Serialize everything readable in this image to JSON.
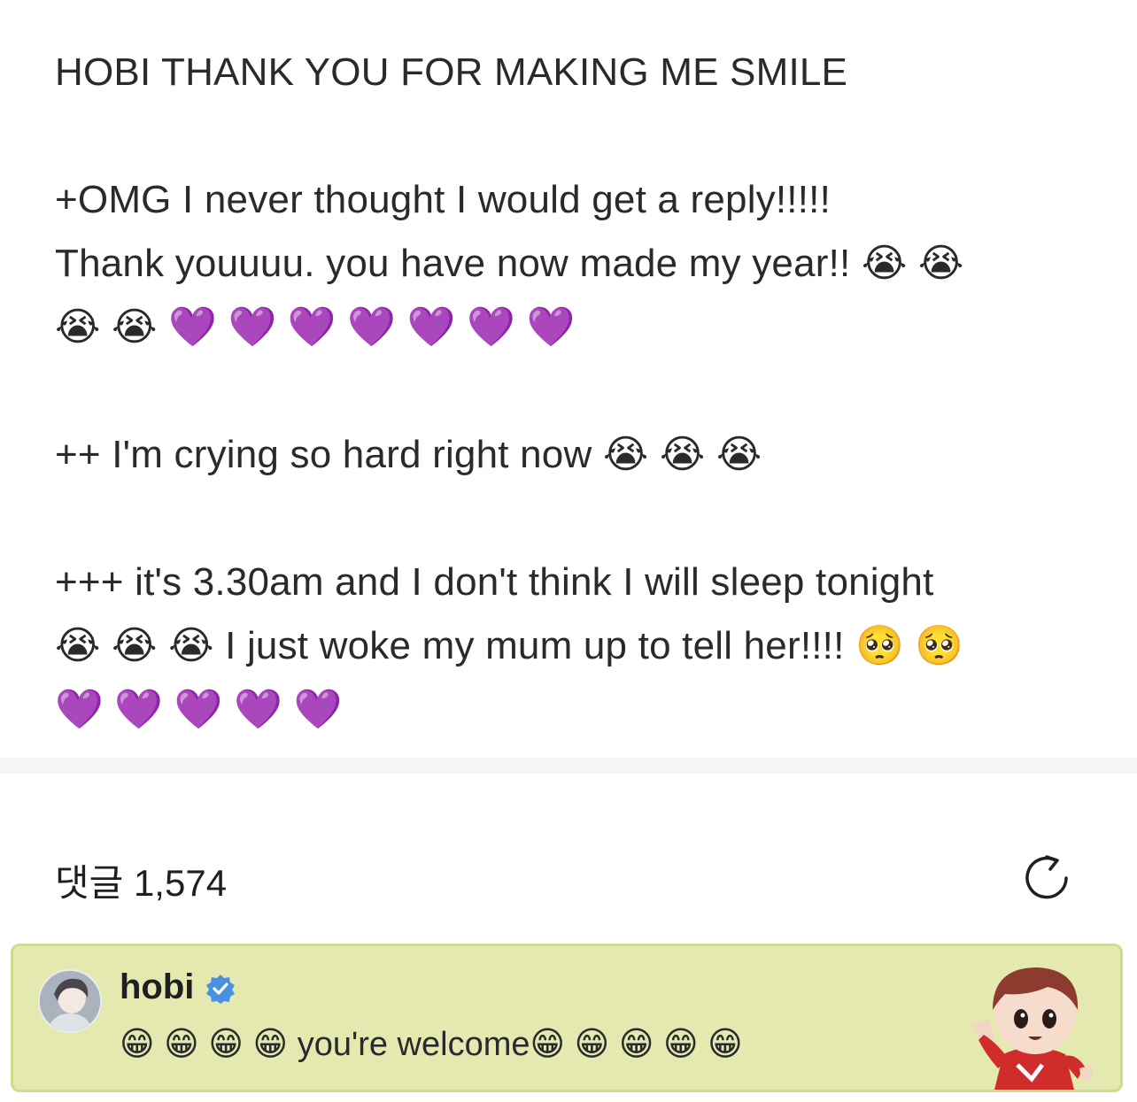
{
  "post": {
    "title": "HOBI THANK YOU FOR MAKING ME SMILE",
    "line_a1": "+OMG I never thought I would get a reply!!!!!",
    "line_a2": "Thank youuuu. you have now made my year!! 😭 😭",
    "line_a3": "😭 😭 💜 💜 💜 💜 💜 💜 💜",
    "line_b1": "++ I'm crying so hard right now 😭 😭 😭",
    "line_c1": "+++ it's 3.30am and I don't think I will sleep tonight",
    "line_c2": "😭 😭 😭 I just woke my mum up to tell her!!!! 🥺 🥺",
    "line_c3": "💜 💜 💜 💜 💜"
  },
  "comments": {
    "title": "댓글 1,574",
    "refresh_icon": "refresh-icon"
  },
  "comment": {
    "author": "hobi",
    "verified_icon": "verified-badge-icon",
    "text": "😁 😁 😁 😁 you're welcome😁 😁 😁 😁 😁",
    "highlight_color": "#e4eaaf"
  }
}
